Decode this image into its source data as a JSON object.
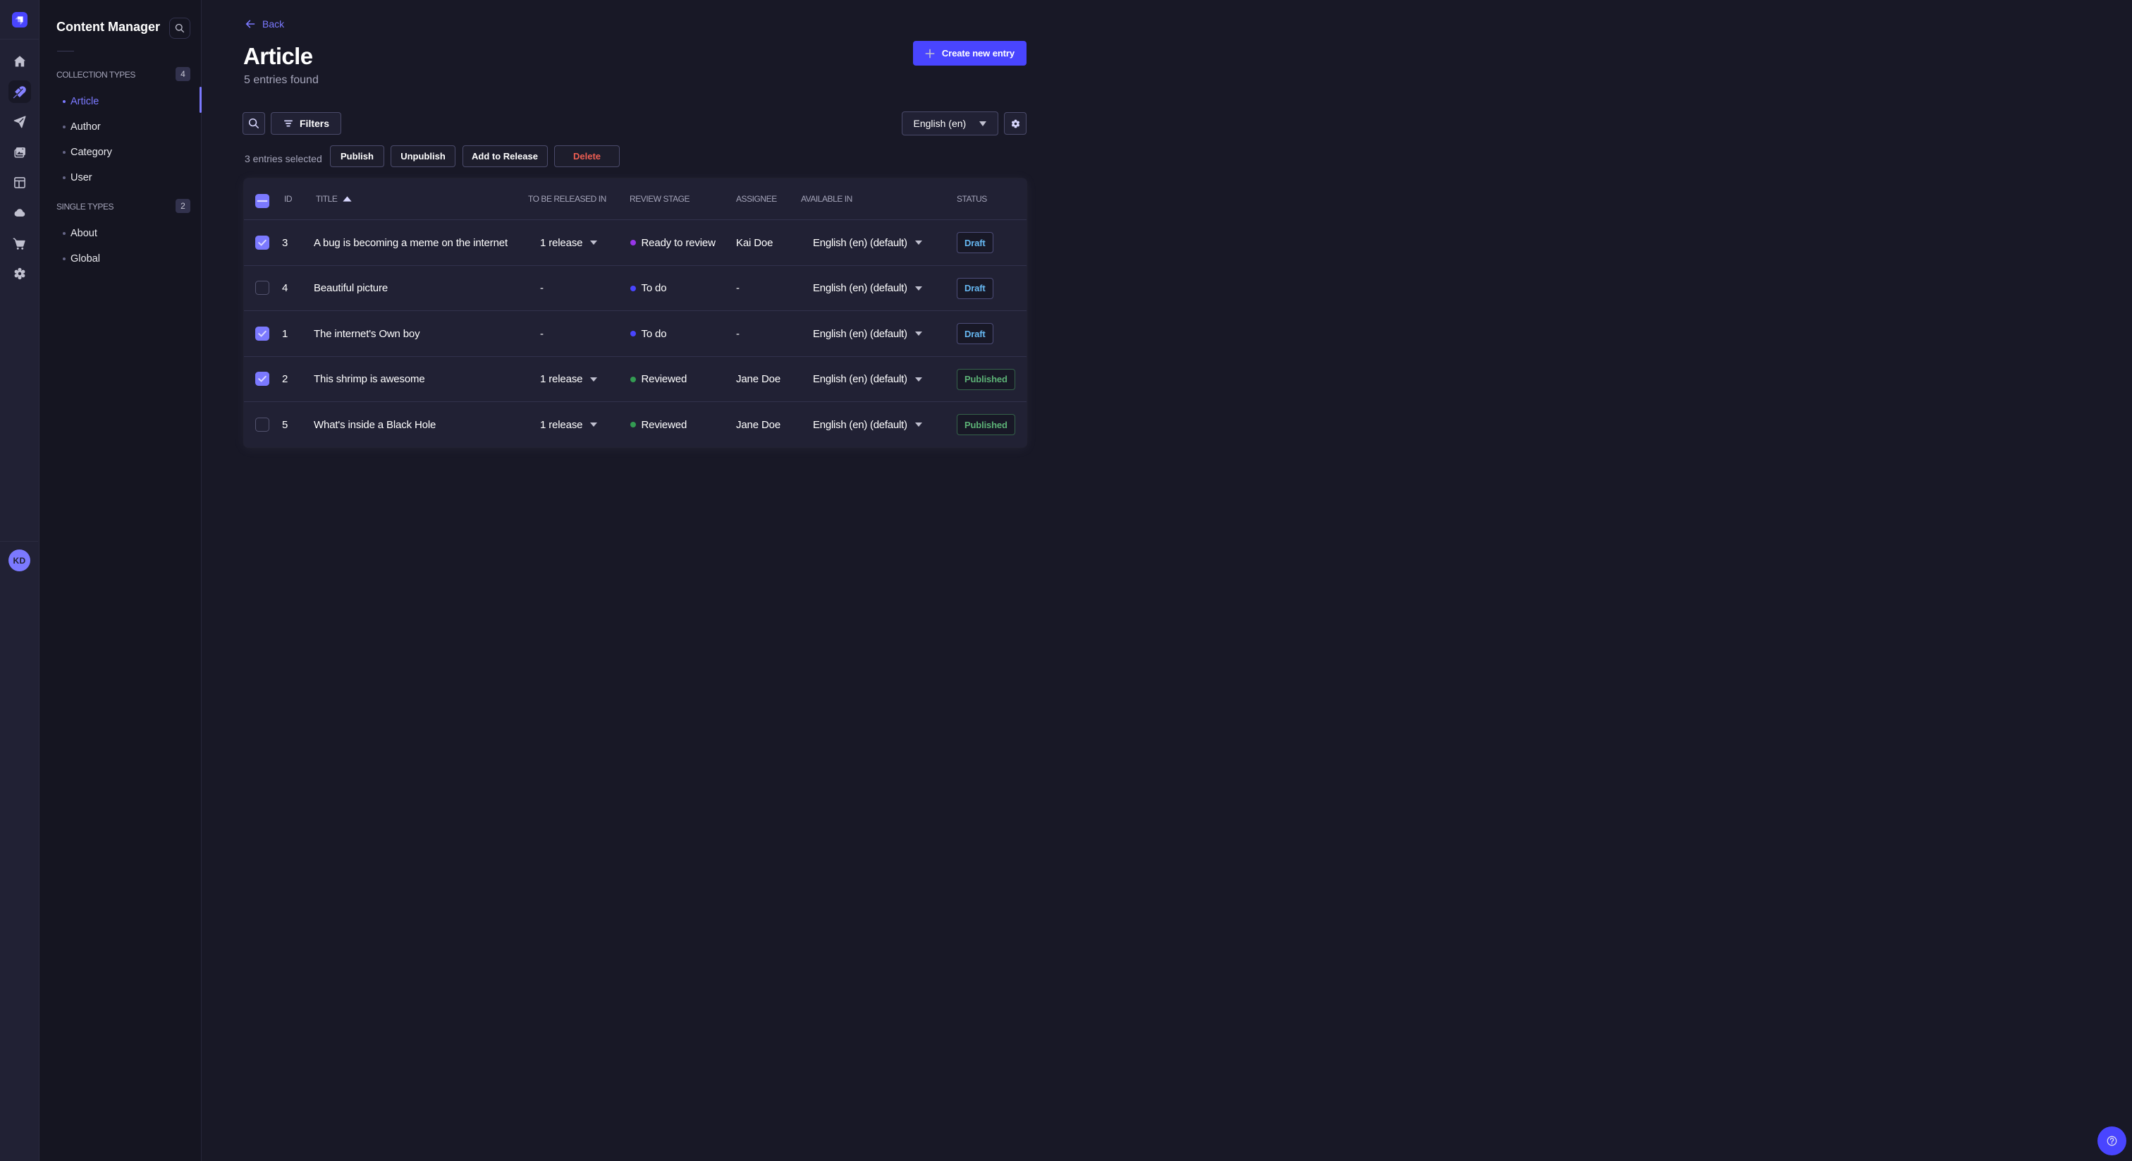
{
  "colors": {
    "primary": "#4945ff",
    "primary_light": "#7b79ff",
    "background": "#181826",
    "rail_background": "#212134",
    "subnav_background": "#151521",
    "card_background": "#212134",
    "danger": "#ee5e52",
    "draft_text": "#66b7f1",
    "published_text": "#5cb176"
  },
  "rail": {
    "logo_icon": "strapi-logo",
    "items": [
      {
        "icon": "home-icon"
      },
      {
        "icon": "feather-icon",
        "active": true
      },
      {
        "icon": "paper-plane-icon"
      },
      {
        "icon": "images-icon"
      },
      {
        "icon": "layout-icon"
      },
      {
        "icon": "cloud-icon"
      },
      {
        "icon": "cart-icon"
      },
      {
        "icon": "gear-icon"
      }
    ],
    "avatar_initials": "KD"
  },
  "sidebar": {
    "title": "Content Manager",
    "search_icon": "search-icon",
    "sections": [
      {
        "label": "COLLECTION TYPES",
        "badge": "4",
        "items": [
          {
            "label": "Article",
            "active": true
          },
          {
            "label": "Author"
          },
          {
            "label": "Category"
          },
          {
            "label": "User"
          }
        ]
      },
      {
        "label": "SINGLE TYPES",
        "badge": "2",
        "items": [
          {
            "label": "About"
          },
          {
            "label": "Global"
          }
        ]
      }
    ]
  },
  "header": {
    "back_label": "Back",
    "title": "Article",
    "subtitle": "5 entries found",
    "create_button": "Create new entry"
  },
  "toolbar": {
    "filters_label": "Filters",
    "locale_value": "English (en)"
  },
  "selection": {
    "label": "3 entries selected",
    "publish": "Publish",
    "unpublish": "Unpublish",
    "add_to_release": "Add to Release",
    "delete": "Delete"
  },
  "table": {
    "columns": {
      "id": "ID",
      "title": "TITLE",
      "released": "TO BE RELEASED IN",
      "review": "REVIEW STAGE",
      "assignee": "ASSIGNEE",
      "available": "AVAILABLE IN",
      "status": "STATUS"
    },
    "rows": [
      {
        "checked": true,
        "id": "3",
        "title": "A bug is becoming a meme on the internet",
        "released": "1 release",
        "released_caret": true,
        "stage": "Ready to review",
        "stage_color": "#9736e8",
        "assignee": "Kai Doe",
        "available": "English (en) (default)",
        "status": "Draft",
        "status_kind": "draft"
      },
      {
        "checked": false,
        "id": "4",
        "title": "Beautiful picture",
        "released": "-",
        "released_caret": false,
        "stage": "To do",
        "stage_color": "#4945ff",
        "assignee": "-",
        "available": "English (en) (default)",
        "status": "Draft",
        "status_kind": "draft"
      },
      {
        "checked": true,
        "id": "1",
        "title": "The internet's Own boy",
        "released": "-",
        "released_caret": false,
        "stage": "To do",
        "stage_color": "#4945ff",
        "assignee": "-",
        "available": "English (en) (default)",
        "status": "Draft",
        "status_kind": "draft"
      },
      {
        "checked": true,
        "id": "2",
        "title": "This shrimp is awesome",
        "released": "1 release",
        "released_caret": true,
        "stage": "Reviewed",
        "stage_color": "#339b52",
        "assignee": "Jane Doe",
        "available": "English (en) (default)",
        "status": "Published",
        "status_kind": "published"
      },
      {
        "checked": false,
        "id": "5",
        "title": "What's inside a Black Hole",
        "released": "1 release",
        "released_caret": true,
        "stage": "Reviewed",
        "stage_color": "#339b52",
        "assignee": "Jane Doe",
        "available": "English (en) (default)",
        "status": "Published",
        "status_kind": "published"
      }
    ]
  }
}
